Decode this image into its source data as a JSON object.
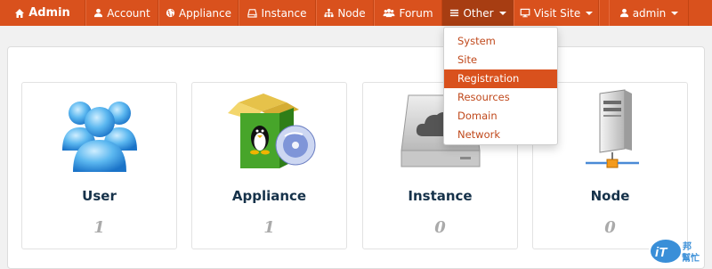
{
  "navbar": {
    "brand": "Admin",
    "items": [
      {
        "label": "Account",
        "icon": "user-icon"
      },
      {
        "label": "Appliance",
        "icon": "globe-icon"
      },
      {
        "label": "Instance",
        "icon": "hdd-icon"
      },
      {
        "label": "Node",
        "icon": "sitemap-icon"
      },
      {
        "label": "Forum",
        "icon": "group-icon"
      },
      {
        "label": "Other",
        "icon": "menu-icon"
      },
      {
        "label": "Visit Site",
        "icon": "monitor-icon"
      },
      {
        "label": "admin",
        "icon": "user-icon"
      }
    ]
  },
  "dropdown": {
    "items": [
      "System",
      "Site",
      "Registration",
      "Resources",
      "Domain",
      "Network"
    ],
    "active": "Registration"
  },
  "cards": [
    {
      "title": "User",
      "value": "1",
      "icon": "users-icon"
    },
    {
      "title": "Appliance",
      "value": "1",
      "icon": "linux-package-icon"
    },
    {
      "title": "Instance",
      "value": "0",
      "icon": "cloud-drive-icon"
    },
    {
      "title": "Node",
      "value": "0",
      "icon": "server-icon"
    }
  ],
  "watermark": {
    "text": "iT邦幫忙"
  },
  "colors": {
    "navbar": "#d9511d",
    "navbar_active": "#a73d12",
    "dropdown_link": "#c0491c",
    "card_title": "#16324a"
  }
}
